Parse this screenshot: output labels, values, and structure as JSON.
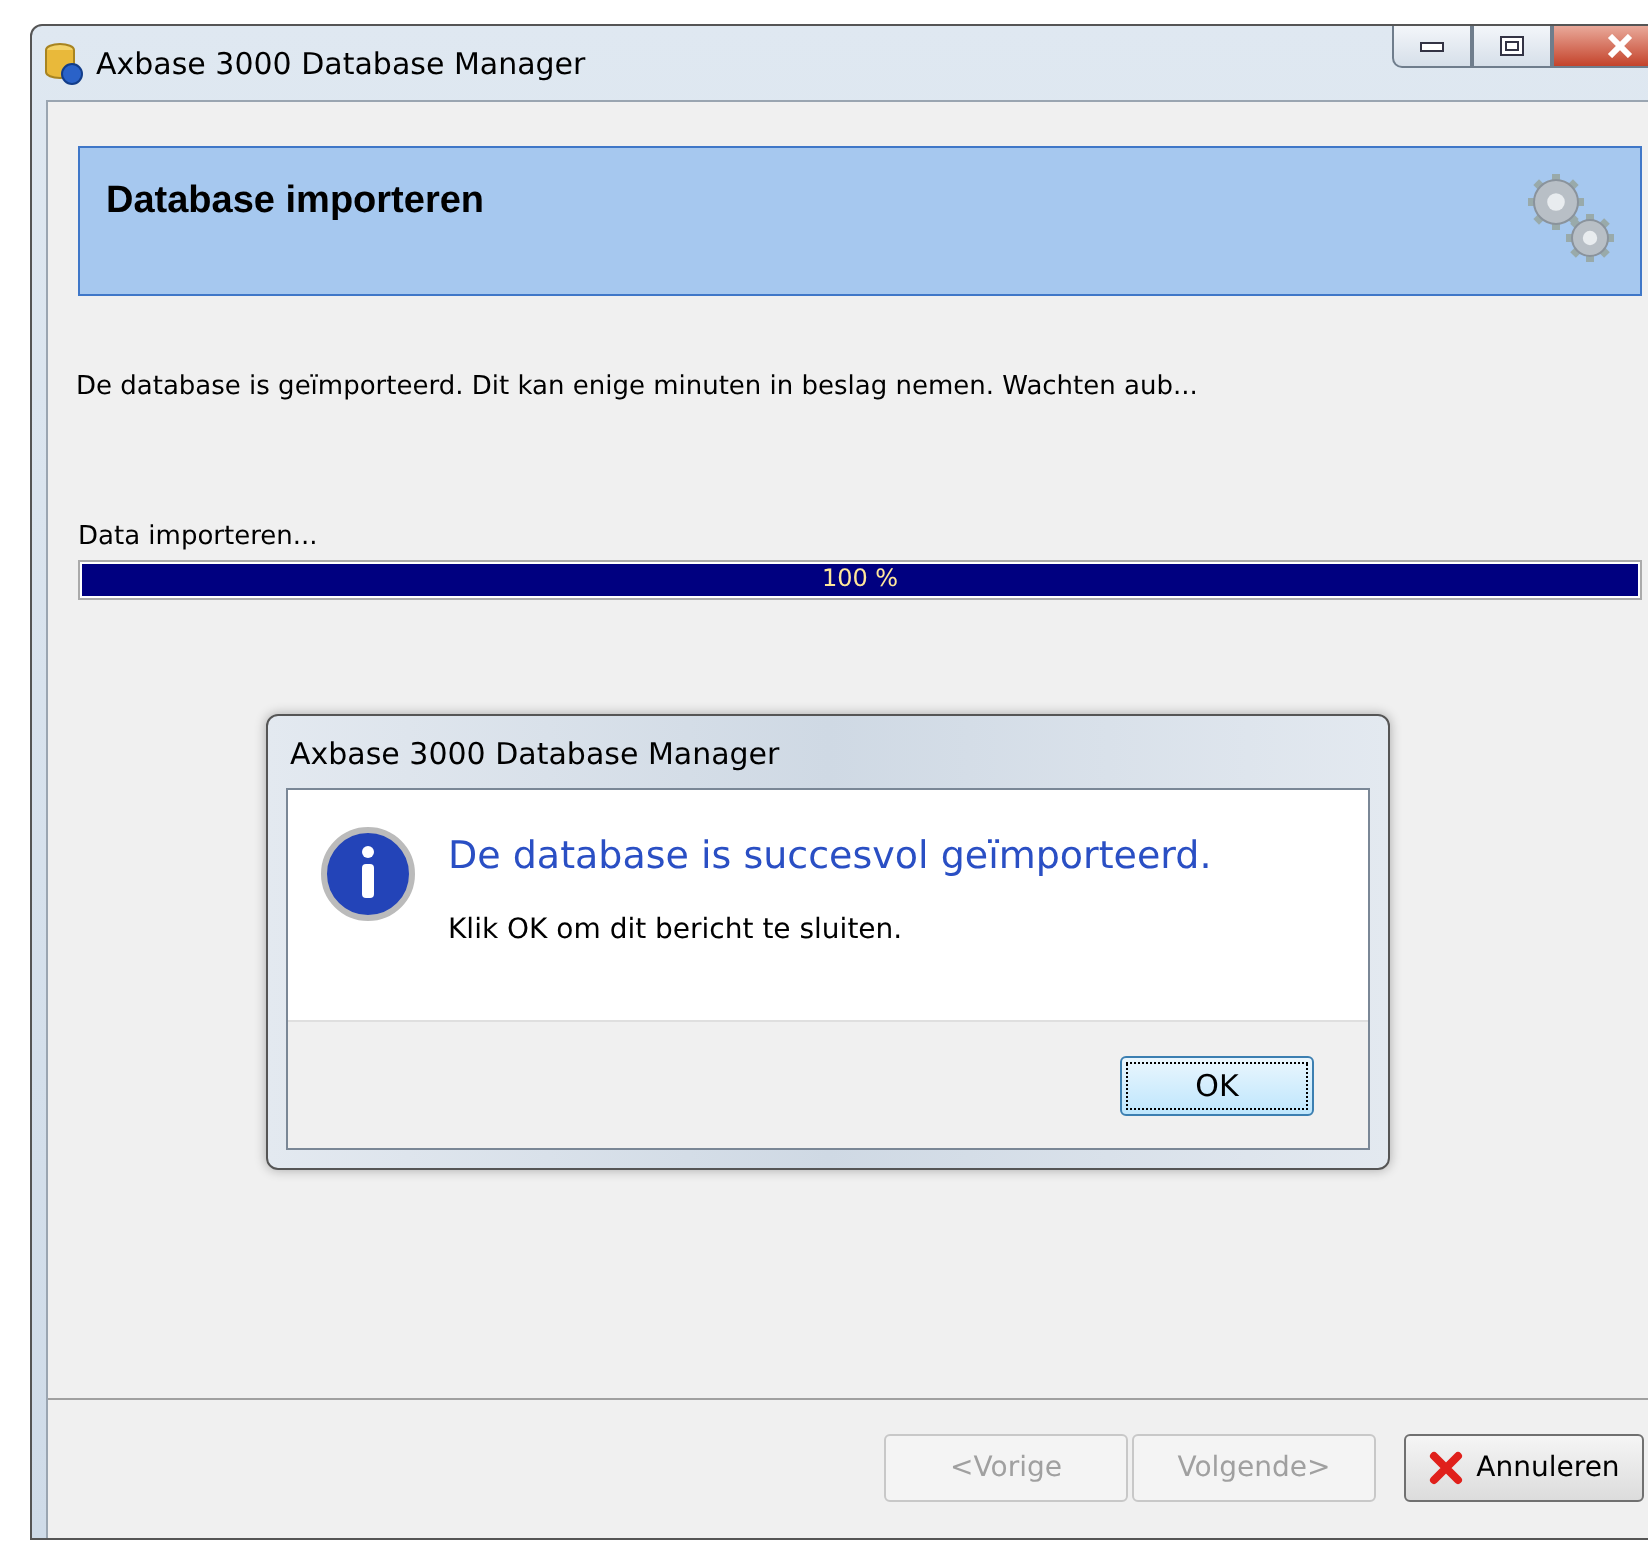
{
  "window": {
    "title": "Axbase 3000 Database Manager"
  },
  "header": {
    "title": "Database importeren"
  },
  "description": "De database is geïmporteerd. Dit kan enige minuten in beslag nemen. Wachten aub...",
  "progress": {
    "label": "Data importeren...",
    "level": 1,
    "reading": "100 %"
  },
  "dialog": {
    "title": "Axbase 3000 Database Manager",
    "heading": "De database is succesvol geïmporteerd.",
    "message": "Klik OK om dit bericht te sluiten.",
    "button": "OK"
  },
  "buttons": [
    {
      "label": "<Vorige",
      "disabled": true,
      "kind": "plain"
    },
    {
      "label": "Volgende>",
      "disabled": true,
      "kind": "plain"
    },
    {
      "label": "Annuleren",
      "disabled": false,
      "kind": "cancel"
    }
  ]
}
